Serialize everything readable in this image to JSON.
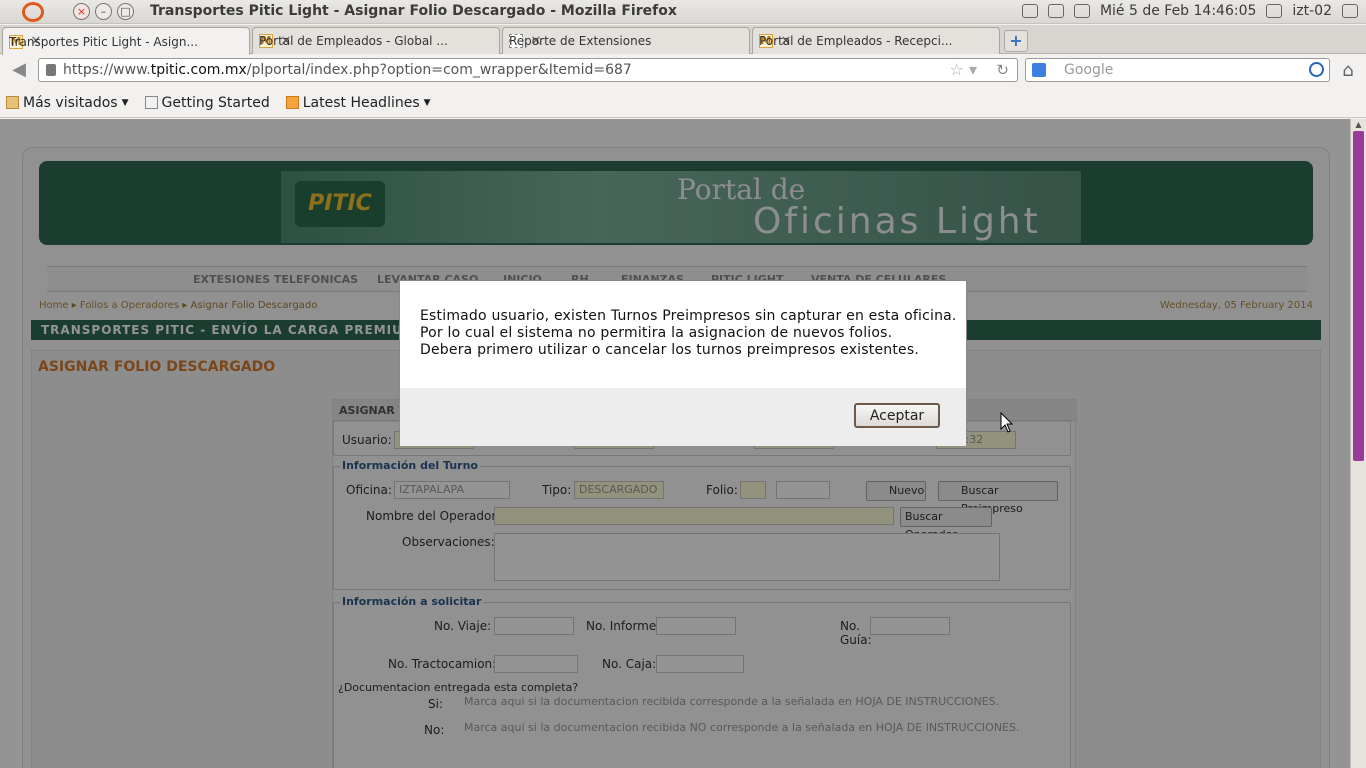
{
  "os": {
    "window_title": "Transportes Pitic Light - Asignar Folio Descargado - Mozilla Firefox",
    "clock": "Mié  5 de Feb 14:46:05",
    "user": "izt-02"
  },
  "tabs": [
    {
      "label": "Transportes Pitic Light - Asign...",
      "icon": "M"
    },
    {
      "label": "Portal de Empleados - Global ...",
      "icon": "M"
    },
    {
      "label": "Reporte de Extensiones",
      "icon": ""
    },
    {
      "label": "Portal de Empleados - Recepci...",
      "icon": "M"
    }
  ],
  "nav": {
    "url_prefix": "https://www.",
    "url_domain": "tpitic.com.mx",
    "url_rest": "/plportal/index.php?option=com_wrapper&Itemid=687",
    "search_placeholder": "Google"
  },
  "bookmarks": [
    {
      "label": "Más visitados",
      "icon": "folder-icon",
      "dropdown": true
    },
    {
      "label": "Getting Started",
      "icon": "page-icon",
      "dropdown": false
    },
    {
      "label": "Latest Headlines",
      "icon": "rss-icon",
      "dropdown": true
    }
  ],
  "page": {
    "banner_line1": "Portal de",
    "banner_line2": "Oficinas Light",
    "banner_logo": "PITIC",
    "menu": [
      "EXTESIONES TELEFONICAS",
      "LEVANTAR CASO",
      "INICIO",
      "RH",
      "FINANZAS",
      "PITIC LIGHT",
      "VENTA DE CELULARES"
    ],
    "breadcrumb": [
      "Home",
      "Folios a Operadores",
      "Asignar Folio Descargado"
    ],
    "date": "Wednesday, 05 February 2014",
    "ticker": "TRANSPORTES PITIC - ENVÍO LA CARGA PREMIUM EL DÍA",
    "section_title": "ASIGNAR FOLIO DESCARGADO",
    "form": {
      "head": "ASIGNAR TU",
      "usuario_label": "Usuario:",
      "time_value": "...45:32",
      "turno_legend": "Información del Turno",
      "oficina_label": "Oficina:",
      "oficina_value": "IZTAPALAPA",
      "tipo_label": "Tipo:",
      "tipo_value": "DESCARGADO",
      "folio_label": "Folio:",
      "nuevo_label": "Nuevo",
      "buscar_preimpreso": "Buscar Preimpreso",
      "operador_label": "Nombre del Operador:",
      "buscar_operador": "Buscar Operador",
      "observaciones_label": "Observaciones:",
      "solicitar_legend": "Información a solicitar",
      "viaje_label": "No. Viaje:",
      "informe_label": "No. Informe:",
      "guia_label": "No. Guía:",
      "tracto_label": "No. Tractocamion:",
      "caja_label": "No. Caja:",
      "doc_question": "¿Documentacion entregada esta completa?",
      "si_label": "Si:",
      "no_label": "No:",
      "si_text": "Marca aqui si la documentacion recibida corresponde a la señalada en HOJA DE INSTRUCCIONES.",
      "no_text": "Marca aqui si la documentacion recibida NO corresponde a la señalada en HOJA DE INSTRUCCIONES."
    }
  },
  "dialog": {
    "line1": "Estimado usuario, existen Turnos Preimpresos sin capturar en esta oficina.",
    "line2": "Por lo cual el sistema no permitira la asignacion de nuevos folios.",
    "line3": "Debera primero utilizar o cancelar los turnos preimpresos existentes.",
    "ok_label": "Aceptar"
  }
}
